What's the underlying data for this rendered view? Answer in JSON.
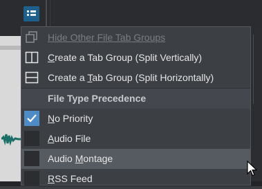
{
  "toolbar": {
    "icon": "tab-group-icon",
    "accent": "#1f5f8b"
  },
  "menu": {
    "items": [
      {
        "label": "Hide Other File Tab Groups",
        "mnemonic_index": 0,
        "icon": "hide-groups-icon",
        "disabled": true
      },
      {
        "label": "Create a Tab Group (Split Vertically)",
        "mnemonic_index": 0,
        "icon": "split-vertical-icon"
      },
      {
        "label": "Create a Tab Group (Split Horizontally)",
        "mnemonic_index": 9,
        "icon": "split-horizontal-icon"
      }
    ],
    "section_header": "File Type Precedence",
    "options": [
      {
        "label": "No Priority",
        "mnemonic_index": 0,
        "checked": true
      },
      {
        "label": "Audio File",
        "mnemonic_index": 0,
        "checked": false
      },
      {
        "label": "Audio Montage",
        "mnemonic_index": 6,
        "checked": false,
        "hovered": true
      },
      {
        "label": "RSS Feed",
        "mnemonic_index": 0,
        "checked": false
      }
    ],
    "check_color": "#4f8bc7"
  }
}
